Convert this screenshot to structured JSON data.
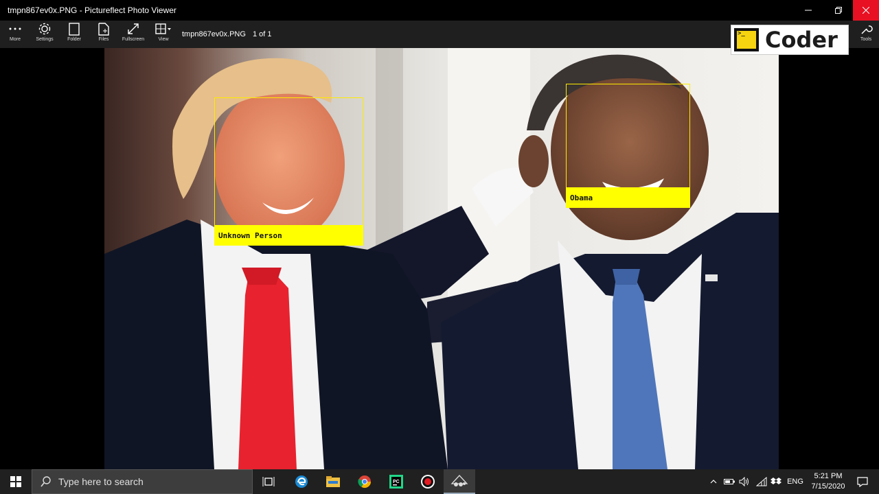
{
  "window": {
    "title": "tmpn867ev0x.PNG - Pictureflect Photo Viewer"
  },
  "toolbar": {
    "items": [
      {
        "label": "More",
        "icon": "more-icon"
      },
      {
        "label": "Settings",
        "icon": "gear-icon"
      },
      {
        "label": "Folder",
        "icon": "folder-icon"
      },
      {
        "label": "Files",
        "icon": "files-icon"
      },
      {
        "label": "Fullscreen",
        "icon": "fullscreen-icon"
      },
      {
        "label": "View",
        "icon": "view-grid-icon"
      }
    ],
    "filename": "tmpn867ev0x.PNG",
    "page_count": "1 of 1",
    "tools_label": "Tools"
  },
  "logo": {
    "prompt": ">_",
    "word": "Coder"
  },
  "photo": {
    "faces": [
      {
        "label": "Unknown Person"
      },
      {
        "label": "Obama"
      }
    ],
    "box_color": "#ffff00"
  },
  "taskbar": {
    "search_placeholder": "Type here to search",
    "apps": [
      "task-view-icon",
      "edge-icon",
      "file-explorer-icon",
      "chrome-icon",
      "pycharm-icon",
      "record-icon",
      "photo-viewer-icon"
    ],
    "language": "ENG",
    "time": "5:21 PM",
    "date": "7/15/2020"
  },
  "colors": {
    "close_button": "#e81123",
    "taskbar": "#202020",
    "toolbar": "#1f1f1f"
  }
}
